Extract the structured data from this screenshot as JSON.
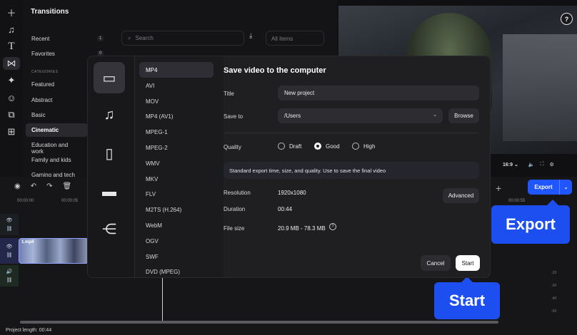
{
  "rail": {
    "icons": [
      "plus-icon",
      "music-icon",
      "text-icon",
      "transitions-icon",
      "effects-icon",
      "stickers-icon",
      "overlay-icon",
      "apps-icon"
    ]
  },
  "panel": {
    "title": "Transitions",
    "recent": {
      "label": "Recent",
      "count": "1"
    },
    "favorites": {
      "label": "Favorites",
      "count": "0"
    },
    "categories_heading": "CATEGORIES",
    "categories": [
      "Featured",
      "Abstract",
      "Basic",
      "Cinematic",
      "Education and work",
      "Family and kids",
      "Gaming and tech"
    ],
    "active_category": "Cinematic",
    "search_placeholder": "Search",
    "filter": "All items"
  },
  "preview": {
    "aspect": "16:9"
  },
  "timeline": {
    "ticks": [
      "00:00:00",
      "00:00:05"
    ],
    "timecode": "00:00:55",
    "clip_name": "1.mp4",
    "project_length": "Project length: 00:44",
    "meter_labels": [
      "-20",
      "-30",
      "-40",
      "-50"
    ]
  },
  "export": {
    "label": "Export",
    "callout": "Export"
  },
  "start_callout": "Start",
  "dialog": {
    "title": "Save video to the computer",
    "formats": [
      "MP4",
      "AVI",
      "MOV",
      "MP4 (AV1)",
      "MPEG-1",
      "MPEG-2",
      "WMV",
      "MKV",
      "FLV",
      "M2TS (H.264)",
      "WebM",
      "OGV",
      "SWF",
      "DVD (MPEG)"
    ],
    "active_format": "MP4",
    "title_label": "Title",
    "title_value": "New project",
    "save_to_label": "Save to",
    "save_to_value": "/Users",
    "browse": "Browse",
    "quality_label": "Quality",
    "quality_options": [
      "Draft",
      "Good",
      "High"
    ],
    "quality_selected": "Good",
    "info": "Standard export time, size, and quality. Use to save the final video",
    "resolution_label": "Resolution",
    "resolution_value": "1920x1080",
    "duration_label": "Duration",
    "duration_value": "00:44",
    "filesize_label": "File size",
    "filesize_value": "20.9 MB - 78.3 MB",
    "advanced": "Advanced",
    "cancel": "Cancel",
    "start": "Start"
  },
  "colors": {
    "accent": "#1f56ff",
    "callout": "#1d4ff0",
    "track": "#1f2a22"
  }
}
